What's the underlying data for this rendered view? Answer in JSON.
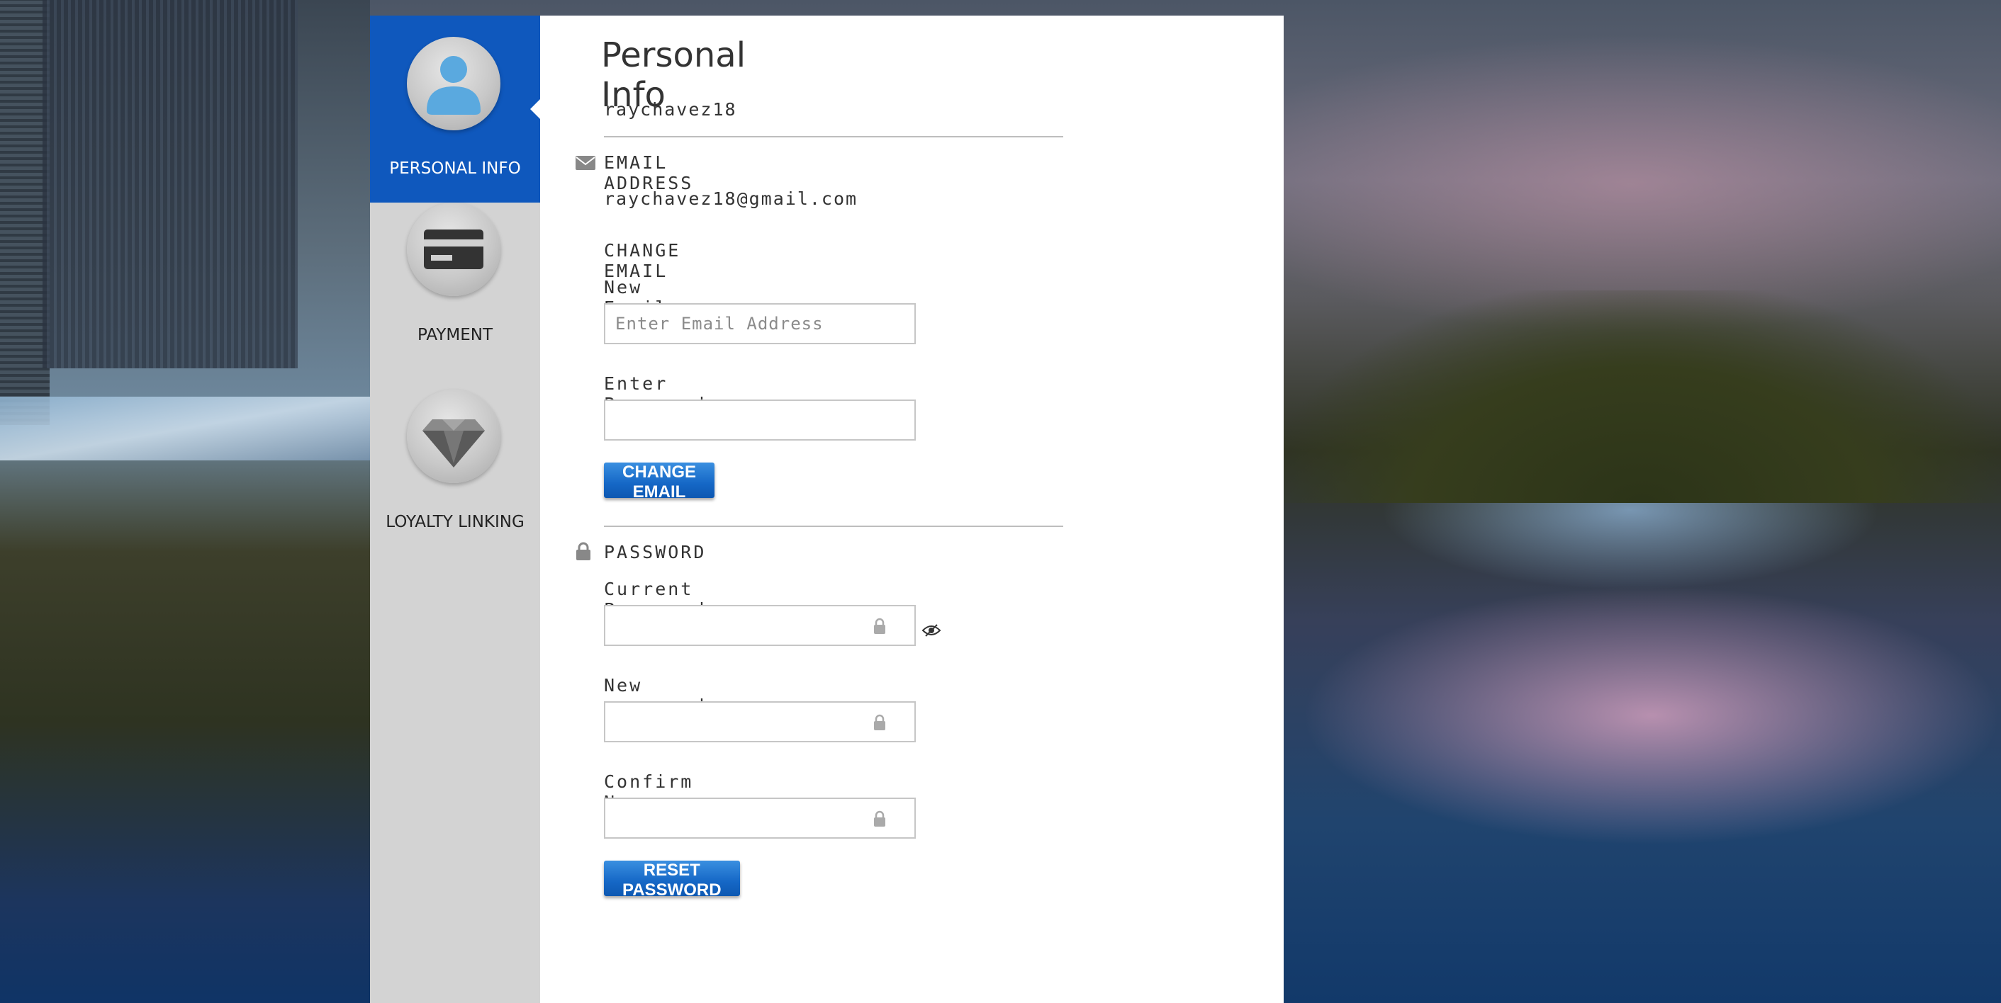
{
  "sidebar": {
    "items": [
      {
        "label": "PERSONAL INFO",
        "icon": "user-icon",
        "active": true
      },
      {
        "label": "PAYMENT",
        "icon": "credit-card-icon",
        "active": false
      },
      {
        "label": "LOYALTY LINKING",
        "icon": "diamond-icon",
        "active": false
      }
    ]
  },
  "main": {
    "title": "Personal Info",
    "username": "raychavez18",
    "email_section": {
      "heading": "EMAIL ADDRESS",
      "icon": "envelope-icon",
      "current_email": "raychavez18@gmail.com",
      "change_heading": "CHANGE EMAIL",
      "new_email_label": "New Email",
      "new_email_placeholder": "Enter Email Address",
      "password_label": "Enter Password",
      "button_label": "CHANGE EMAIL"
    },
    "password_section": {
      "heading": "PASSWORD",
      "icon": "lock-icon",
      "current_label": "Current Password:",
      "new_label": "New password:",
      "confirm_label": "Confirm New Password",
      "button_label": "RESET PASSWORD"
    }
  },
  "colors": {
    "active_nav": "#0f58bd",
    "sidebar_bg": "#d3d3d3",
    "button": "#1567c6"
  }
}
